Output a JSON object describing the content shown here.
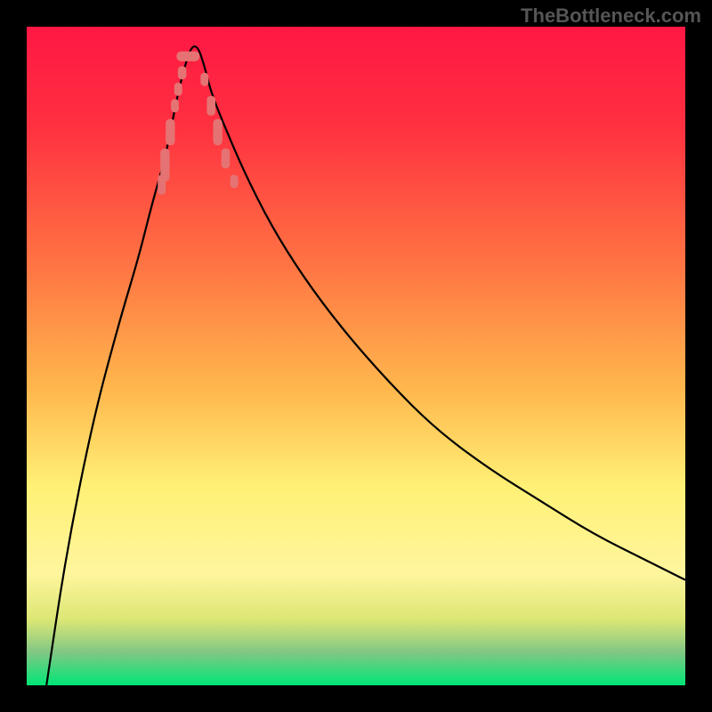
{
  "watermark": "TheBottleneck.com",
  "chart_data": {
    "type": "line",
    "title": "",
    "xlabel": "",
    "ylabel": "",
    "x_range": [
      0,
      100
    ],
    "y_range": [
      0,
      100
    ],
    "gradient_stops": [
      {
        "offset": 0,
        "color": "#ff1744"
      },
      {
        "offset": 15,
        "color": "#ff3040"
      },
      {
        "offset": 35,
        "color": "#ff7043"
      },
      {
        "offset": 55,
        "color": "#ffb74d"
      },
      {
        "offset": 70,
        "color": "#fff176"
      },
      {
        "offset": 83,
        "color": "#fff59d"
      },
      {
        "offset": 90,
        "color": "#dce775"
      },
      {
        "offset": 95,
        "color": "#81c784"
      },
      {
        "offset": 100,
        "color": "#00e676"
      }
    ],
    "series": [
      {
        "name": "bottleneck-curve",
        "type": "v-curve",
        "color": "#000000",
        "x": [
          3,
          6,
          10,
          14,
          17,
          19,
          21,
          22,
          23,
          24,
          25,
          26,
          27,
          28,
          30,
          33,
          37,
          42,
          48,
          55,
          62,
          70,
          78,
          86,
          94,
          100
        ],
        "y": [
          0,
          20,
          40,
          55,
          65,
          73,
          80,
          85,
          90,
          94,
          97,
          97,
          94,
          90,
          85,
          78,
          70,
          62,
          54,
          46,
          39,
          33,
          28,
          23,
          19,
          16
        ]
      }
    ],
    "markers": {
      "color": "#e57373",
      "left_branch": [
        {
          "x": 20.5,
          "y": 76,
          "w": 1.2,
          "h": 3
        },
        {
          "x": 21,
          "y": 79,
          "w": 1.4,
          "h": 5
        },
        {
          "x": 21.8,
          "y": 84,
          "w": 1.4,
          "h": 4
        },
        {
          "x": 22.5,
          "y": 88,
          "w": 1.2,
          "h": 2
        },
        {
          "x": 23,
          "y": 90.5,
          "w": 1.2,
          "h": 2
        },
        {
          "x": 23.6,
          "y": 93,
          "w": 1.3,
          "h": 2
        }
      ],
      "right_branch": [
        {
          "x": 27,
          "y": 92,
          "w": 1.2,
          "h": 2
        },
        {
          "x": 28,
          "y": 88,
          "w": 1.3,
          "h": 3
        },
        {
          "x": 29,
          "y": 84,
          "w": 1.4,
          "h": 4
        },
        {
          "x": 30.2,
          "y": 80,
          "w": 1.3,
          "h": 3
        },
        {
          "x": 31.5,
          "y": 76.5,
          "w": 1.2,
          "h": 2
        }
      ],
      "bottom": [
        {
          "x": 24.5,
          "y": 95.5,
          "w": 3.5,
          "h": 1.5
        }
      ]
    }
  }
}
